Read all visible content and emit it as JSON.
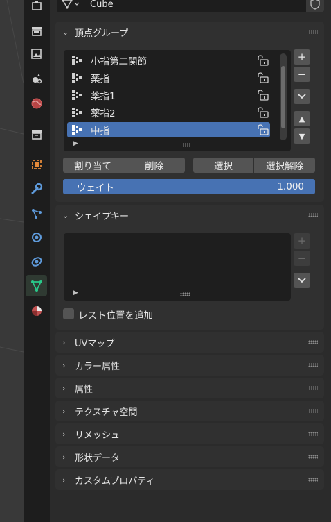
{
  "object": {
    "name": "Cube"
  },
  "vertex_groups": {
    "title": "頂点グループ",
    "items": [
      {
        "label": "小指第二関節",
        "selected": false
      },
      {
        "label": "薬指",
        "selected": false
      },
      {
        "label": "薬指1",
        "selected": false
      },
      {
        "label": "薬指2",
        "selected": false
      },
      {
        "label": "中指",
        "selected": true
      }
    ],
    "side_buttons": {
      "add": "+",
      "remove": "−",
      "specials": "⌄",
      "move_up": "▲",
      "move_down": "▼"
    },
    "assign_label": "割り当て",
    "remove_label": "削除",
    "select_label": "選択",
    "deselect_label": "選択解除",
    "weight_label": "ウェイト",
    "weight_value": "1.000"
  },
  "shape_keys": {
    "title": "シェイプキー",
    "side_buttons": {
      "add": "+",
      "remove": "−",
      "specials": "⌄"
    },
    "relative_checkbox": {
      "label": "レスト位置を追加",
      "checked": false
    }
  },
  "collapsed_panels": [
    "UVマップ",
    "カラー属性",
    "属性",
    "テクスチャ空間",
    "リメッシュ",
    "形状データ",
    "カスタムプロパティ"
  ],
  "tabs": [
    "tool-icon",
    "render-icon",
    "output-icon",
    "view-layer-icon",
    "scene-icon",
    "world-icon",
    "collection-icon",
    "object-icon",
    "modifier-icon",
    "particles-icon",
    "physics-icon",
    "constraints-icon",
    "data-icon",
    "material-icon"
  ],
  "colors": {
    "accent": "#4772b3",
    "panel": "#303030",
    "background": "#2b2b2b",
    "active_tab": "#1ea86e"
  }
}
